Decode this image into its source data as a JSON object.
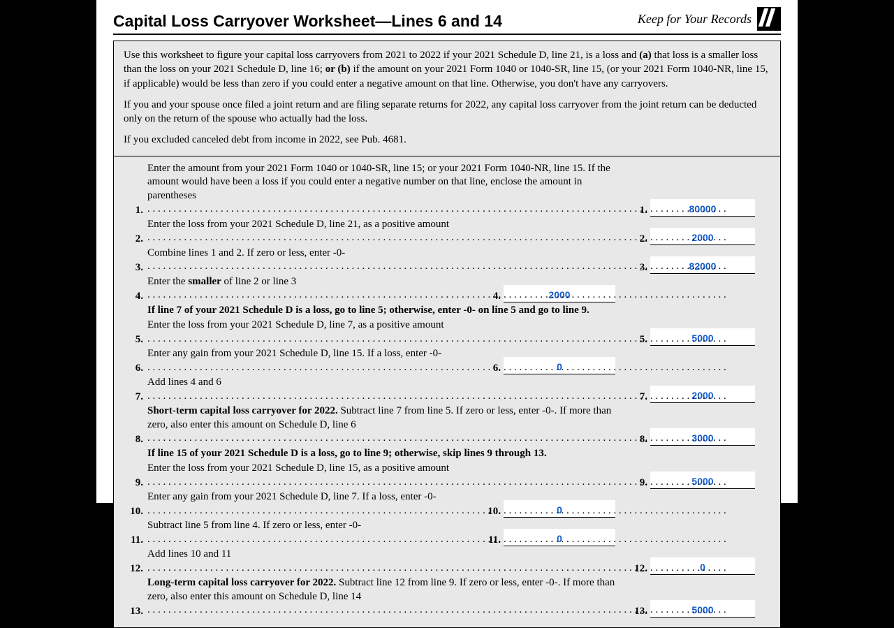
{
  "header": {
    "title": "Capital Loss Carryover Worksheet—Lines 6 and 14",
    "keep": "Keep for Your Records"
  },
  "intro": {
    "p1a": "Use this worksheet to figure your capital loss carryovers from 2021 to 2022 if your 2021 Schedule D, line 21, is a loss and ",
    "p1b": "(a)",
    "p1c": " that loss is a smaller loss than the loss on your 2021 Schedule D, line 16; ",
    "p1d": "or (b)",
    "p1e": " if the amount on your 2021 Form 1040 or 1040-SR, line 15, (or your 2021 Form 1040-NR, line 15, if applicable) would be less than zero if you could enter a negative amount on that line. Otherwise, you don't have any carryovers.",
    "p2": "If you and your spouse once filed a joint return and are filing separate returns for 2022, any capital loss carryover from the joint return can be deducted only on the return of the spouse who actually had the loss.",
    "p3": "If you excluded canceled debt from income in 2022, see Pub. 4681."
  },
  "lines": {
    "l1": {
      "n": "1.",
      "t": "Enter the amount from your 2021 Form 1040 or 1040-SR, line 15; or your 2021 Form 1040-NR, line 15. If the amount would have been a loss if you could enter a negative number on that line, enclose the amount in parentheses",
      "rn": "1.",
      "v": "80000"
    },
    "l2": {
      "n": "2.",
      "t": "Enter the loss from your 2021 Schedule D, line 21, as a positive amount",
      "rn": "2.",
      "v": "2000"
    },
    "l3": {
      "n": "3.",
      "t": "Combine lines 1 and 2. If zero or less, enter -0-",
      "rn": "3.",
      "v": "82000"
    },
    "l4": {
      "n": "4.",
      "ta": "Enter the ",
      "tb": "smaller",
      "tc": " of line 2 or line 3",
      "mn": "4.",
      "v": "2000"
    },
    "hint1": "If line 7 of your 2021 Schedule D is a loss, go to line 5; otherwise, enter -0- on line 5 and go to line 9.",
    "l5": {
      "n": "5.",
      "t": "Enter the loss from your 2021 Schedule D, line 7, as a positive amount",
      "rn": "5.",
      "v": "5000"
    },
    "l6": {
      "n": "6.",
      "t": "Enter any gain from your 2021 Schedule D, line 15. If a loss, enter -0-",
      "mn": "6.",
      "v": "0"
    },
    "l7": {
      "n": "7.",
      "t": "Add lines 4 and 6",
      "rn": "7.",
      "v": "2000"
    },
    "l8": {
      "n": "8.",
      "ta": "Short-term capital loss carryover for 2022.",
      "tb": " Subtract line 7 from line 5. If zero or less, enter -0-. If more than zero, also enter this amount on Schedule D, line 6",
      "rn": "8.",
      "v": "3000"
    },
    "hint2": "If line 15 of your 2021 Schedule D is a loss, go to line 9; otherwise, skip lines 9 through 13.",
    "l9": {
      "n": "9.",
      "t": "Enter the loss from your 2021 Schedule D, line 15, as a positive amount",
      "rn": "9.",
      "v": "5000"
    },
    "l10": {
      "n": "10.",
      "t": "Enter any gain from your 2021 Schedule D, line 7. If a loss, enter -0-",
      "mn": "10.",
      "v": "0"
    },
    "l11": {
      "n": "11.",
      "t": "Subtract line 5 from line 4. If zero or less, enter -0-",
      "mn": "11.",
      "v": "0"
    },
    "l12": {
      "n": "12.",
      "t": "Add lines 10 and 11",
      "rn": "12.",
      "v": "0"
    },
    "l13": {
      "n": "13.",
      "ta": "Long-term capital loss carryover for 2022.",
      "tb": " Subtract line 12 from line 9. If zero or less, enter -0-. If more than zero, also enter this amount on Schedule D, line 14",
      "rn": "13.",
      "v": "5000"
    }
  }
}
